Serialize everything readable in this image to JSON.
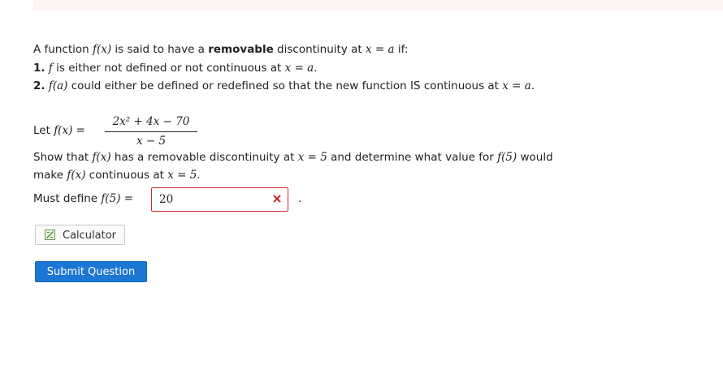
{
  "intro": {
    "prefix": "A function ",
    "fx": "f(x)",
    "middle": " is said to have a ",
    "bold_word": "removable",
    "after_bold": " discontinuity at ",
    "x_eq_a": "x = a",
    "suffix": " if:"
  },
  "conditions": [
    {
      "number": "1.",
      "f": "f",
      "text": " is either not defined or not continuous at ",
      "math": "x = a",
      "end": "."
    },
    {
      "number": "2.",
      "fa": "f(a)",
      "text": " could either be defined or redefined so that the new function IS continuous at ",
      "math": "x = a",
      "end": "."
    }
  ],
  "definition": {
    "let": "Let ",
    "fx_eq": "f(x) =",
    "numerator": "2x² + 4x − 70",
    "denominator": "x − 5"
  },
  "task": {
    "line1_a": "Show that ",
    "line1_fx": "f(x)",
    "line1_b": " has a removable discontinuity at ",
    "line1_math": "x = 5",
    "line1_c": " and determine what value for ",
    "line1_f5": "f(5)",
    "line1_d": " would",
    "line2_a": "make ",
    "line2_fx": "f(x)",
    "line2_b": " continuous at ",
    "line2_math": "x = 5."
  },
  "answer": {
    "label": "Must define ",
    "f5": "f(5)",
    "equals": "=",
    "value": "20",
    "status": "incorrect",
    "status_icon": "x-mark-icon",
    "status_color": "#cc2b2b",
    "trailing": "."
  },
  "buttons": {
    "calculator_label": "Calculator",
    "calculator_icon": "calculator-icon",
    "submit_label": "Submit Question",
    "submit_color": "#1c77d4"
  }
}
